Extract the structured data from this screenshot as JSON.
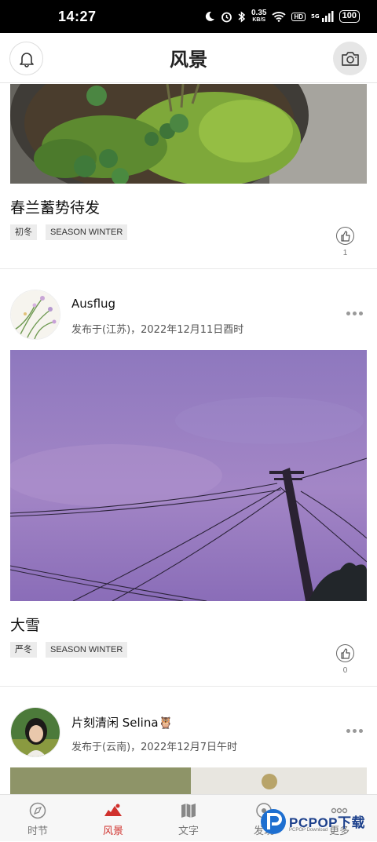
{
  "status_bar": {
    "time": "14:27",
    "net_speed_value": "0.35",
    "net_speed_unit": "KB/S",
    "hd_badge": "HD",
    "signal_label": "5G",
    "battery": "100"
  },
  "header": {
    "title": "风景",
    "left_icon": "bell-icon",
    "right_icon": "camera-icon"
  },
  "posts": [
    {
      "title": "春兰蓄势待发",
      "tags": [
        "初冬",
        "SEASON WINTER"
      ],
      "likes": "1"
    },
    {
      "author": "Ausflug",
      "meta": "发布于(江苏)，2022年12月11日酉时",
      "title": "大雪",
      "tags": [
        "严冬",
        "SEASON WINTER"
      ],
      "likes": "0"
    },
    {
      "author": "片刻清闲 Selina🦉",
      "meta": "发布于(云南)，2022年12月7日午时"
    }
  ],
  "nav": {
    "items": [
      {
        "label": "时节",
        "icon": "compass-icon"
      },
      {
        "label": "风景",
        "icon": "landscape-icon",
        "active": true
      },
      {
        "label": "文字",
        "icon": "map-icon"
      },
      {
        "label": "发现",
        "icon": "discover-icon"
      },
      {
        "label": "更多",
        "icon": "more-icon"
      }
    ]
  },
  "watermark": {
    "brand": "PCPOP下载",
    "sub": "PCPOP Download"
  },
  "colors": {
    "accent": "#d0312d",
    "status_bar": "#000000",
    "tag_bg": "#ececec"
  }
}
